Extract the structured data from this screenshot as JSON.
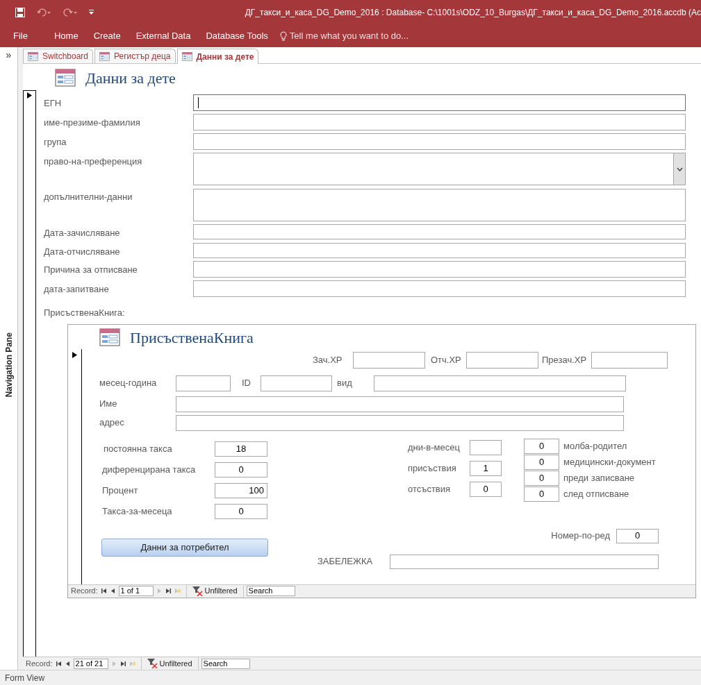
{
  "window": {
    "title": "ДГ_такси_и_каса_DG_Demo_2016 : Database- C:\\1001s\\ODZ_10_Burgas\\ДГ_такси_и_каса_DG_Demo_2016.accdb (Ac"
  },
  "ribbon": {
    "tabs": [
      "File",
      "Home",
      "Create",
      "External Data",
      "Database Tools"
    ],
    "tell_me": "Tell me what you want to do..."
  },
  "navigation_pane": {
    "label": "Navigation Pane",
    "toggle": "»"
  },
  "document_tabs": [
    {
      "label": "Switchboard",
      "selected": false
    },
    {
      "label": "Регистър деца",
      "selected": false
    },
    {
      "label": "Данни за дете",
      "selected": true
    }
  ],
  "form": {
    "title": "Данни за дете",
    "fields": [
      {
        "label": "ЕГН",
        "kind": "text",
        "focused": true
      },
      {
        "label": "име-презиме-фамилия",
        "kind": "text",
        "focused": false
      },
      {
        "label": "група",
        "kind": "text",
        "focused": false
      },
      {
        "label": "право-на-преференция",
        "kind": "combo",
        "focused": false
      },
      {
        "label": "допълнителни-данни",
        "kind": "memo",
        "focused": false
      },
      {
        "label": "Дата-зачисляване",
        "kind": "short",
        "focused": false
      },
      {
        "label": "Дата-отчисляване",
        "kind": "short",
        "focused": false
      },
      {
        "label": "Причина за отписване",
        "kind": "text",
        "focused": false
      },
      {
        "label": "дата-запитване",
        "kind": "text",
        "focused": false
      }
    ],
    "subform_label": "ПрисъственаКнига:",
    "subform": {
      "title": "ПрисъственаКнига",
      "top_fields": [
        {
          "label": "Зач.ХР"
        },
        {
          "label": "Отч.ХР"
        },
        {
          "label": "Презач.ХР"
        }
      ],
      "period_fields": [
        {
          "label": "месец-година"
        },
        {
          "label": "ID"
        },
        {
          "label": "вид"
        }
      ],
      "name": {
        "label": "Име"
      },
      "address": {
        "label": "адрес"
      },
      "fees": [
        {
          "label": "постоянна такса",
          "value": "18"
        },
        {
          "label": "диференцирана такса",
          "value": "0"
        },
        {
          "label": "Процент",
          "value": "100"
        },
        {
          "label": "Такса-за-месеца",
          "value": "0"
        }
      ],
      "attendance": [
        {
          "label": "дни-в-месец"
        },
        {
          "label": "присъствия",
          "value": "1"
        },
        {
          "label": "отсъствия",
          "value": "0"
        }
      ],
      "counters": [
        {
          "value": "0",
          "label": "молба-родител"
        },
        {
          "value": "0",
          "label": "медицински-документ"
        },
        {
          "value": "0",
          "label": "преди записване"
        },
        {
          "value": "0",
          "label": "след отписване"
        }
      ],
      "button": "Данни за потребител",
      "order": {
        "label": "Номер-по-ред",
        "value": "0"
      },
      "note": {
        "label": "ЗАБЕЛЕЖКА"
      },
      "navigator": {
        "label": "Record:",
        "position": "1 of 1",
        "filter": "Unfiltered",
        "search": "Search"
      }
    }
  },
  "record_navigator": {
    "label": "Record:",
    "position": "21 of 21",
    "filter": "Unfiltered",
    "search": "Search"
  },
  "status_bar": "Form View"
}
